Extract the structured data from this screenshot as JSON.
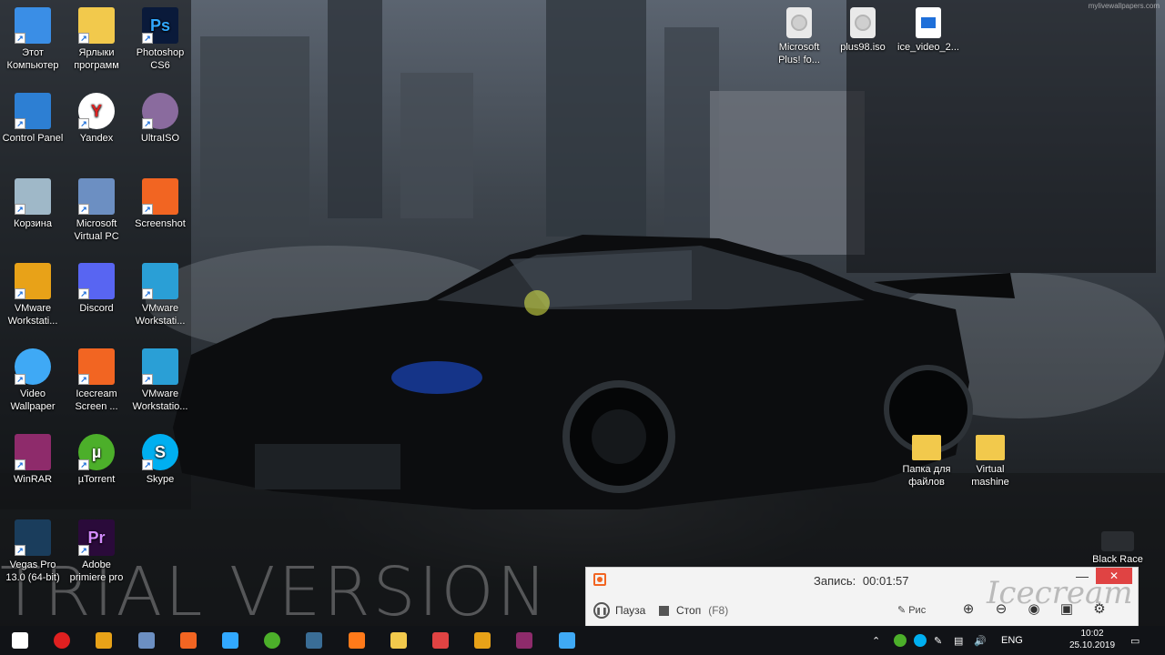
{
  "wallpaper": {
    "site": "mylivewallpapers.com",
    "trial_text": "TRIAL VERSION"
  },
  "desktop_icons": [
    {
      "label": "Этот Компьютер",
      "icon": "computer-icon",
      "color": "#3a8ee6"
    },
    {
      "label": "Ярлыки программ",
      "icon": "folder-shortcut-icon",
      "color": "#f2c94c"
    },
    {
      "label": "Photoshop CS6",
      "icon": "photoshop-icon",
      "color": "#0a1a3a",
      "text": "Ps"
    },
    {
      "label": "Control Panel",
      "icon": "control-panel-icon",
      "color": "#2d7fd3"
    },
    {
      "label": "Yandex",
      "icon": "yandex-icon",
      "color": "#ffffff",
      "text": "Y"
    },
    {
      "label": "UltraISO",
      "icon": "ultraiso-icon",
      "color": "#8a6b9e"
    },
    {
      "label": "Корзина",
      "icon": "recycle-bin-icon",
      "color": "#9fb8c8"
    },
    {
      "label": "Microsoft Virtual PC",
      "icon": "virtual-pc-icon",
      "color": "#6c8fc2"
    },
    {
      "label": "Screenshot",
      "icon": "screenshot-icon",
      "color": "#f26522"
    },
    {
      "label": "VMware Workstati...",
      "icon": "vmware-icon",
      "color": "#e8a218"
    },
    {
      "label": "Discord",
      "icon": "discord-icon",
      "color": "#5865f2"
    },
    {
      "label": "VMware Workstati...",
      "icon": "vmware-icon",
      "color": "#2a9fd6"
    },
    {
      "label": "Video Wallpaper",
      "icon": "video-wallpaper-icon",
      "color": "#3fa9f5"
    },
    {
      "label": "Icecream Screen ...",
      "icon": "icecream-icon",
      "color": "#f26522"
    },
    {
      "label": "VMware Workstatio...",
      "icon": "vmware-icon",
      "color": "#2a9fd6"
    },
    {
      "label": "WinRAR",
      "icon": "winrar-icon",
      "color": "#8e2b6b"
    },
    {
      "label": "µTorrent",
      "icon": "utorrent-icon",
      "color": "#4caf2a",
      "text": "µ"
    },
    {
      "label": "Skype",
      "icon": "skype-icon",
      "color": "#00aff0",
      "text": "S"
    },
    {
      "label": "Vegas Pro 13.0 (64-bit)",
      "icon": "vegas-icon",
      "color": "#1a3d5c"
    },
    {
      "label": "Adobe primiere pro",
      "icon": "premiere-icon",
      "color": "#2a0a3a",
      "text": "Pr"
    }
  ],
  "top_icons": [
    {
      "label": "Microsoft Plus! fo...",
      "icon": "disc-image-icon"
    },
    {
      "label": "plus98.iso",
      "icon": "disc-image-icon"
    },
    {
      "label": "ice_video_2...",
      "icon": "video-file-icon"
    }
  ],
  "right_icons": [
    {
      "label": "Папка для файлов",
      "icon": "folder-icon"
    },
    {
      "label": "Virtual mashine",
      "icon": "folder-icon"
    },
    {
      "label": "Black Race",
      "icon": "car-shortcut-icon"
    }
  ],
  "recorder": {
    "title": "Запись:",
    "time": "00:01:57",
    "pause": "Пауза",
    "stop": "Стоп",
    "stop_hint": "(F8)",
    "draw": "Рис",
    "brand": "Icecream",
    "close": "✕",
    "minimize": "—"
  },
  "taskbar": {
    "items": [
      {
        "icon": "windows-start-icon"
      },
      {
        "icon": "yandex-browser-icon"
      },
      {
        "icon": "vmware-icon"
      },
      {
        "icon": "virtualbox-icon"
      },
      {
        "icon": "icecream-icon"
      },
      {
        "icon": "photoshop-icon"
      },
      {
        "icon": "utorrent-icon"
      },
      {
        "icon": "vegas-icon"
      },
      {
        "icon": "headphones-icon"
      },
      {
        "icon": "file-explorer-icon"
      },
      {
        "icon": "gift-icon"
      },
      {
        "icon": "vmware-icon"
      },
      {
        "icon": "winrar-icon"
      },
      {
        "icon": "video-wallpaper-icon"
      }
    ],
    "language": "ENG",
    "time": "10:02",
    "date": "25.10.2019"
  }
}
